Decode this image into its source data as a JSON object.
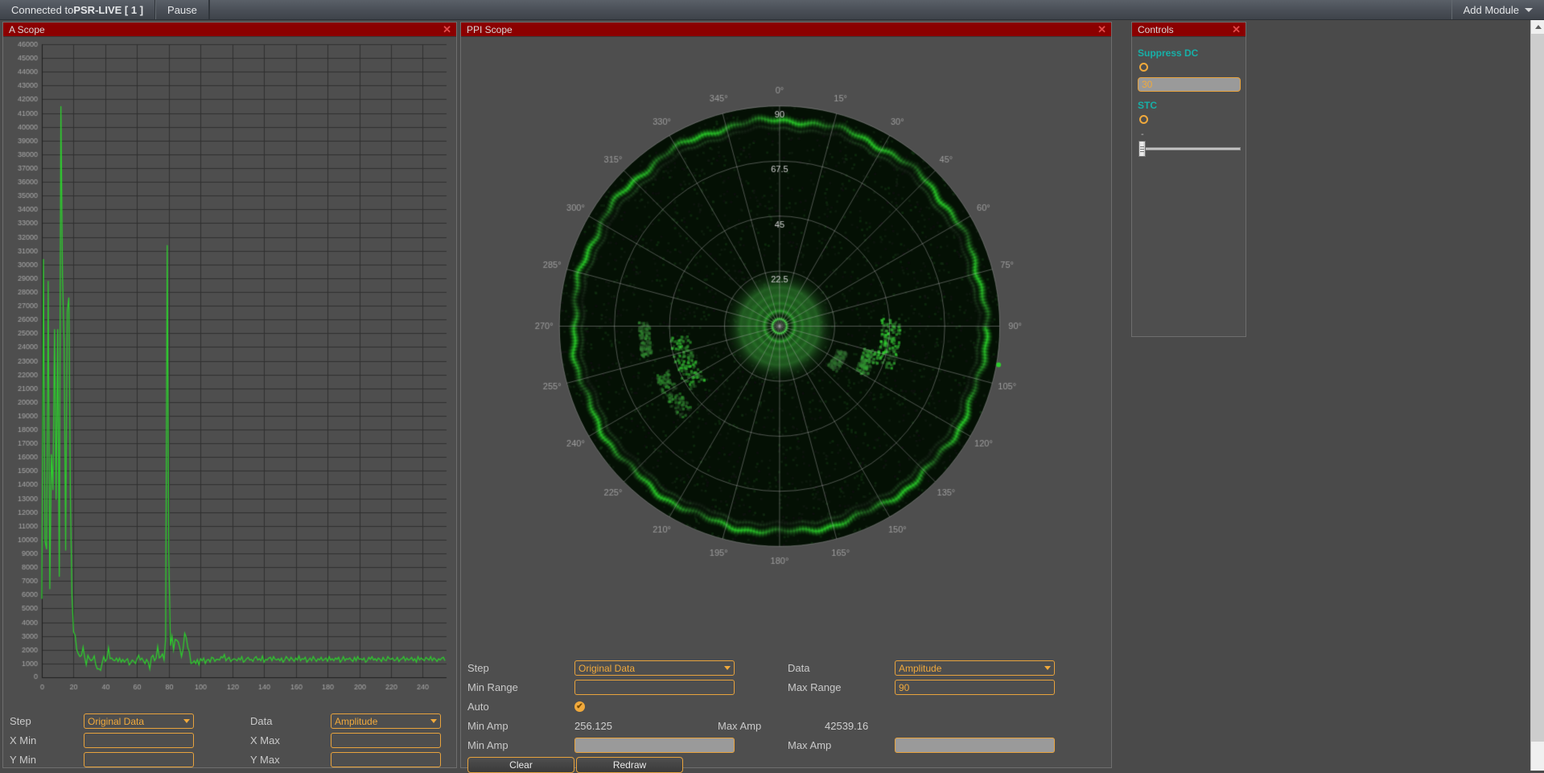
{
  "topbar": {
    "connection_prefix": "Connected to ",
    "connection_name": "PSR-LIVE [ 1 ]",
    "pause_label": "Pause",
    "add_module_label": "Add Module"
  },
  "panels": {
    "ascope_title": "A Scope",
    "ppi_title": "PPI Scope",
    "controls_title": "Controls",
    "close_glyph": "✕"
  },
  "ascope_form": {
    "step_label": "Step",
    "step_value": "Original Data",
    "data_label": "Data",
    "data_value": "Amplitude",
    "x_min_label": "X Min",
    "x_min_value": "",
    "x_max_label": "X Max",
    "x_max_value": "",
    "y_min_label": "Y Min",
    "y_min_value": "",
    "y_max_label": "Y Max",
    "y_max_value": ""
  },
  "ppi_form": {
    "step_label": "Step",
    "step_value": "Original Data",
    "data_label": "Data",
    "data_value": "Amplitude",
    "min_range_label": "Min Range",
    "min_range_value": "",
    "max_range_label": "Max Range",
    "max_range_value": "90",
    "auto_label": "Auto",
    "auto_checked": true,
    "check_glyph": "✔",
    "min_amp_stat_label": "Min Amp",
    "min_amp_stat_value": "256.125",
    "max_amp_stat_label": "Max Amp",
    "max_amp_stat_value": "42539.16",
    "min_amp_label": "Min Amp",
    "min_amp_value": "",
    "max_amp_label": "Max Amp",
    "max_amp_value": "",
    "clear_label": "Clear",
    "redraw_label": "Redraw"
  },
  "controls": {
    "suppress_dc_label": "Suppress DC",
    "suppress_dc_value": "30",
    "stc_label": "STC",
    "stc_tick": "-"
  },
  "colors": {
    "accent_orange": "#f0a93c",
    "title_red": "#8b0000",
    "teal_label": "#17b0a8",
    "trace_green": "#2ecc2e",
    "panel_bg": "#4e4e4e"
  },
  "chart_data": {
    "type": "line",
    "title": "A Scope",
    "xlabel": "",
    "ylabel": "",
    "xlim": [
      0,
      255
    ],
    "ylim": [
      0,
      46000
    ],
    "xticks": [
      0,
      20,
      40,
      60,
      80,
      100,
      120,
      140,
      160,
      180,
      200,
      220,
      240
    ],
    "yticks": [
      0,
      1000,
      2000,
      3000,
      4000,
      5000,
      6000,
      7000,
      8000,
      9000,
      10000,
      11000,
      12000,
      13000,
      14000,
      15000,
      16000,
      17000,
      18000,
      19000,
      20000,
      21000,
      22000,
      23000,
      24000,
      25000,
      26000,
      27000,
      28000,
      29000,
      30000,
      31000,
      32000,
      33000,
      34000,
      35000,
      36000,
      37000,
      38000,
      39000,
      40000,
      41000,
      42000,
      43000,
      44000,
      45000,
      46000
    ],
    "grid": true,
    "series": [
      {
        "name": "Amplitude",
        "color": "#2ecc2e",
        "x": [
          0,
          1,
          2,
          3,
          4,
          5,
          6,
          7,
          8,
          9,
          10,
          11,
          12,
          13,
          14,
          15,
          16,
          17,
          18,
          19,
          20,
          21,
          22,
          23,
          24,
          25,
          26,
          27,
          28,
          29,
          30,
          31,
          32,
          33,
          34,
          35,
          36,
          37,
          38,
          39,
          40,
          41,
          42,
          43,
          44,
          45,
          46,
          47,
          48,
          49,
          50,
          51,
          52,
          53,
          54,
          55,
          56,
          57,
          58,
          59,
          60,
          61,
          62,
          63,
          64,
          65,
          66,
          67,
          68,
          69,
          70,
          71,
          72,
          73,
          74,
          75,
          76,
          77,
          78,
          79,
          80,
          81,
          82,
          83,
          84,
          85,
          86,
          87,
          88,
          89,
          90,
          91,
          92,
          93,
          94,
          95,
          96,
          97,
          98,
          99,
          100,
          101,
          102,
          103,
          104,
          105,
          106,
          107,
          108,
          109,
          110,
          111,
          112,
          113,
          114,
          115,
          116,
          117,
          118,
          119,
          120,
          121,
          122,
          123,
          124,
          125,
          126,
          127,
          128,
          129,
          130,
          131,
          132,
          133,
          134,
          135,
          136,
          137,
          138,
          139,
          140,
          141,
          142,
          143,
          144,
          145,
          146,
          147,
          148,
          149,
          150,
          151,
          152,
          153,
          154,
          155,
          156,
          157,
          158,
          159,
          160,
          161,
          162,
          163,
          164,
          165,
          166,
          167,
          168,
          169,
          170,
          171,
          172,
          173,
          174,
          175,
          176,
          177,
          178,
          179,
          180,
          181,
          182,
          183,
          184,
          185,
          186,
          187,
          188,
          189,
          190,
          191,
          192,
          193,
          194,
          195,
          196,
          197,
          198,
          199,
          200,
          201,
          202,
          203,
          204,
          205,
          206,
          207,
          208,
          209,
          210,
          211,
          212,
          213,
          214,
          215,
          216,
          217,
          218,
          219,
          220,
          221,
          222,
          223,
          224,
          225,
          226,
          227,
          228,
          229,
          230,
          231,
          232,
          233,
          234,
          235,
          236,
          237,
          238,
          239,
          240,
          241,
          242,
          243,
          244,
          245,
          246,
          247,
          248,
          249,
          250,
          251,
          252,
          253,
          254,
          255
        ],
        "y": [
          5700,
          30400,
          9900,
          9300,
          28800,
          6400,
          16200,
          13600,
          25300,
          12900,
          25300,
          7300,
          41500,
          29200,
          24500,
          9200,
          26600,
          27600,
          13200,
          5900,
          3300,
          3050,
          2000,
          1700,
          1500,
          1600,
          2200,
          1450,
          900,
          1600,
          1350,
          1200,
          1300,
          1550,
          900,
          600,
          620,
          500,
          1050,
          1500,
          1150,
          1350,
          2150,
          1350,
          1400,
          1250,
          1200,
          1400,
          1150,
          1400,
          1100,
          1300,
          1100,
          1250,
          1350,
          900,
          1050,
          1250,
          1150,
          1000,
          1350,
          1600,
          1250,
          1400,
          1200,
          1000,
          1300,
          1100,
          600,
          1450,
          1600,
          1200,
          1400,
          2250,
          1400,
          1500,
          1700,
          1250,
          2800,
          31400,
          8900,
          2300,
          3000,
          2000,
          2750,
          2700,
          2550,
          2100,
          1500,
          2050,
          3200,
          2900,
          2150,
          1850,
          1000,
          1050,
          1200,
          1000,
          1300,
          900,
          1350,
          1200,
          1400,
          1000,
          1250,
          1300,
          1100,
          1450,
          1400,
          1150,
          1300,
          1300,
          1250,
          1500,
          1400,
          1650,
          1200,
          1350,
          1450,
          1150,
          1250,
          1350,
          1300,
          1200,
          1400,
          1250,
          1500,
          1100,
          1200,
          1350,
          1450,
          1250,
          1300,
          1150,
          1400,
          1500,
          1250,
          1350,
          1200,
          1550,
          1100,
          1300,
          1250,
          1400,
          1450,
          1200,
          1500,
          1300,
          1250,
          1350,
          1200,
          1400,
          1100,
          1250,
          1500,
          1350,
          1200,
          1450,
          1300,
          1150,
          1400,
          1250,
          1550,
          1200,
          1350,
          1300,
          1450,
          1100,
          1250,
          1400,
          1200,
          1500,
          1300,
          1150,
          1350,
          1250,
          1450,
          1200,
          1300,
          1400,
          1150,
          1500,
          1250,
          1350,
          1200,
          1400,
          1300,
          1450,
          1100,
          1250,
          1500,
          1200,
          1350,
          1300,
          1400,
          1250,
          1150,
          1450,
          1200,
          1500,
          1300,
          1350,
          1250,
          1400,
          1100,
          1200,
          1450,
          1300,
          1500,
          1250,
          1350,
          1200,
          1400,
          1300,
          1150,
          1450,
          1250,
          1200,
          1500,
          1350,
          1300,
          1400,
          1200,
          1250,
          1450,
          1150,
          1300,
          1350,
          1500,
          1200,
          1400,
          1250,
          1300,
          1450,
          1200,
          1350,
          1100,
          1500,
          1250,
          1400,
          1300,
          1200,
          1450,
          1350,
          1250,
          1500,
          1200,
          1400,
          1300,
          1150,
          1350,
          1250,
          1400,
          1450,
          1200
        ]
      }
    ]
  },
  "ppi_data": {
    "type": "polar-radar",
    "angle_labels": [
      "0°",
      "15°",
      "30°",
      "45°",
      "60°",
      "75°",
      "90°",
      "105°",
      "120°",
      "135°",
      "150°",
      "165°",
      "180°",
      "195°",
      "210°",
      "225°",
      "240°",
      "255°",
      "270°",
      "285°",
      "300°",
      "315°",
      "330°",
      "345°"
    ],
    "range_rings": [
      "22.5",
      "45",
      "67.5",
      "90"
    ],
    "max_range": 90
  }
}
